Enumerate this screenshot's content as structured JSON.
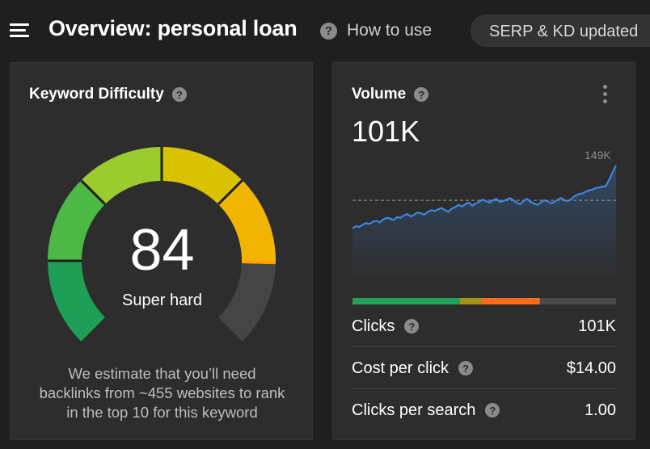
{
  "header": {
    "title": "Overview: personal loan",
    "help_label": "How to use",
    "status_label": "SERP & KD updated"
  },
  "keyword_difficulty": {
    "title": "Keyword Difficulty",
    "score": "84",
    "score_value": 84,
    "score_max": 100,
    "level_label": "Super hard",
    "estimate_line1": "We estimate that you’ll need",
    "estimate_line2": "backlinks from ~455 websites to rank",
    "estimate_line3": "in the top 10 for this keyword",
    "gauge_colors": [
      "#1f9e55",
      "#4cb944",
      "#9bcc2e",
      "#d9c300",
      "#f1b400",
      "#ff9f00",
      "#454545"
    ]
  },
  "volume": {
    "title": "Volume",
    "value": "101K",
    "max_label": "149K",
    "trend": [
      64,
      67,
      66,
      69,
      71,
      70,
      73,
      74,
      72,
      76,
      78,
      77,
      75,
      79,
      78,
      81,
      83,
      80,
      82,
      85,
      84,
      82,
      86,
      88,
      87,
      89,
      91,
      88,
      86,
      90,
      92,
      95,
      93,
      96,
      98,
      94,
      97,
      99,
      102,
      100,
      98,
      101,
      103,
      99,
      100,
      102,
      104,
      101,
      98,
      96,
      100,
      103,
      99,
      97,
      95,
      98,
      101,
      100,
      97,
      99,
      102,
      104,
      101,
      100,
      103,
      107,
      109,
      110,
      112,
      114,
      115,
      117,
      118,
      119,
      120,
      128,
      138,
      147
    ],
    "reference_value": 101,
    "distribution": [
      {
        "share": 0.55,
        "color": "#23a35a"
      },
      {
        "share": 0.11,
        "color": "#a39213"
      },
      {
        "share": 0.3,
        "color": "#ff6b1a"
      },
      {
        "share": 0.39,
        "color": "#4a4a4a"
      }
    ],
    "clicks_label": "Clicks",
    "clicks_value": "101K",
    "cpc_label": "Cost per click",
    "cpc_value": "$14.00",
    "cps_label": "Clicks per search",
    "cps_value": "1.00"
  },
  "colors": {
    "background": "#1f1f1f",
    "card": "#2d2d2d",
    "line": "#3d87e0"
  },
  "icons": [
    "menu-icon",
    "help-icon",
    "more-vertical-icon"
  ]
}
